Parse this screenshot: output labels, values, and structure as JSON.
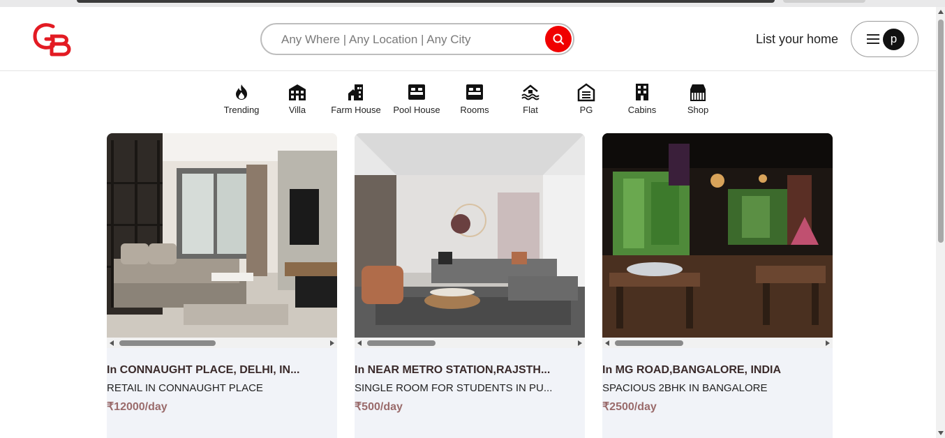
{
  "header": {
    "logo_text": "GB",
    "search_placeholder": "Any Where | Any Location | Any City",
    "list_home_label": "List your home",
    "avatar_letter": "p"
  },
  "categories": [
    {
      "label": "Trending",
      "icon": "flame-icon"
    },
    {
      "label": "Villa",
      "icon": "villa-icon"
    },
    {
      "label": "Farm House",
      "icon": "farm-house-icon"
    },
    {
      "label": "Pool House",
      "icon": "bed-icon"
    },
    {
      "label": "Rooms",
      "icon": "bed-icon"
    },
    {
      "label": "Flat",
      "icon": "water-house-icon"
    },
    {
      "label": "PG",
      "icon": "building-icon"
    },
    {
      "label": "Cabins",
      "icon": "tower-icon"
    },
    {
      "label": "Shop",
      "icon": "shop-icon"
    }
  ],
  "listings": [
    {
      "location": "In CONNAUGHT PLACE, DELHI, IN...",
      "title": "RETAIL IN CONNAUGHT PLACE",
      "price": "₹12000/day"
    },
    {
      "location": "In NEAR METRO STATION,RAJSTH...",
      "title": "SINGLE ROOM FOR STUDENTS IN PU...",
      "price": "₹500/day"
    },
    {
      "location": "In MG ROAD,BANGALORE, INDIA",
      "title": "SPACIOUS 2BHK IN BANGALORE",
      "price": "₹2500/day"
    }
  ],
  "colors": {
    "accent": "#f00000",
    "logo": "#e31b23",
    "price": "#9a6b6b",
    "card_bg": "#f1f3f8"
  }
}
